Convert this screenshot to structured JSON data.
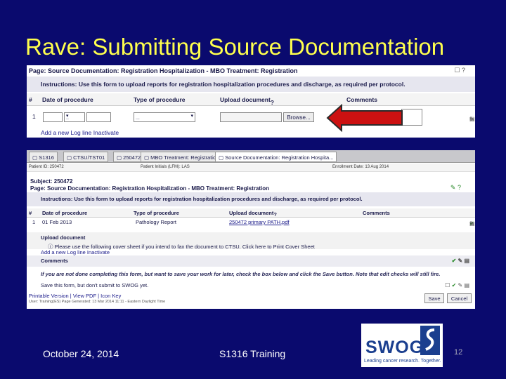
{
  "slide": {
    "title": "Rave: Submitting Source Documentation",
    "footer_date": "October 24, 2014",
    "footer_center": "S1316 Training",
    "page_number": "12",
    "logo_text": "SWOG",
    "logo_tagline": "Leading cancer research. Together.",
    "colors": {
      "background": "#0a0a6e",
      "title": "#ffff4d",
      "arrow": "#cc1111",
      "logo": "#1b3f8f"
    }
  },
  "screenshot1": {
    "page_title": "Page: Source Documentation: Registration Hospitalization - MBO Treatment: Registration",
    "instructions": "Instructions: Use this form to upload reports for registration hospitalization procedures and discharge, as required per protocol.",
    "columns": [
      "#",
      "Date of procedure",
      "Type of procedure",
      "Upload document",
      "Comments"
    ],
    "row_number": "1",
    "date_select": "..",
    "type_select": "...",
    "browse_label": "Browse...",
    "add_line": "Add a new Log line",
    "inactivate": "Inactivate"
  },
  "screenshot2": {
    "tabs": [
      "S1316",
      "CTSU/TST01",
      "250472",
      "MBO Treatment: Registration",
      "Source Documentation: Registration Hospita..."
    ],
    "patient_id": "Patient ID: 250472",
    "patient_initials": "Patient Initials (LFM): LAS",
    "enrollment_date": "Enrollment Date: 13 Aug 2014",
    "subject": "Subject: 250472",
    "page_title": "Page: Source Documentation: Registration Hospitalization - MBO Treatment: Registration",
    "instructions": "Instructions: Use this form to upload reports for registration hospitalization procedures and discharge, as required per protocol.",
    "columns": [
      "#",
      "Date of procedure",
      "Type of procedure",
      "Upload document",
      "Comments"
    ],
    "row": {
      "num": "1",
      "date": "01 Feb 2013",
      "type": "Pathology Report",
      "file": "250472 primary PATH.pdf"
    },
    "upload_heading": "Upload document",
    "upload_note": "Please use the following cover sheet if you intend to fax the document to CTSU. Click here to Print Cover Sheet",
    "add_line": "Add a new Log line",
    "inactivate": "Inactivate",
    "comments": "Comments",
    "warning": "If you are not done completing this form, but want to save your work for later, check the box below and click the Save button. Note that edit checks will still fire.",
    "save_note": "Save this form, but don't submit to SWOG yet.",
    "links": "Printable Version | View PDF | Icon Key",
    "meta": "User: Training(ES)    Page Generated: 13 Mar 2014 11:11 - Eastern Daylight Time",
    "save_label": "Save",
    "cancel_label": "Cancel"
  }
}
